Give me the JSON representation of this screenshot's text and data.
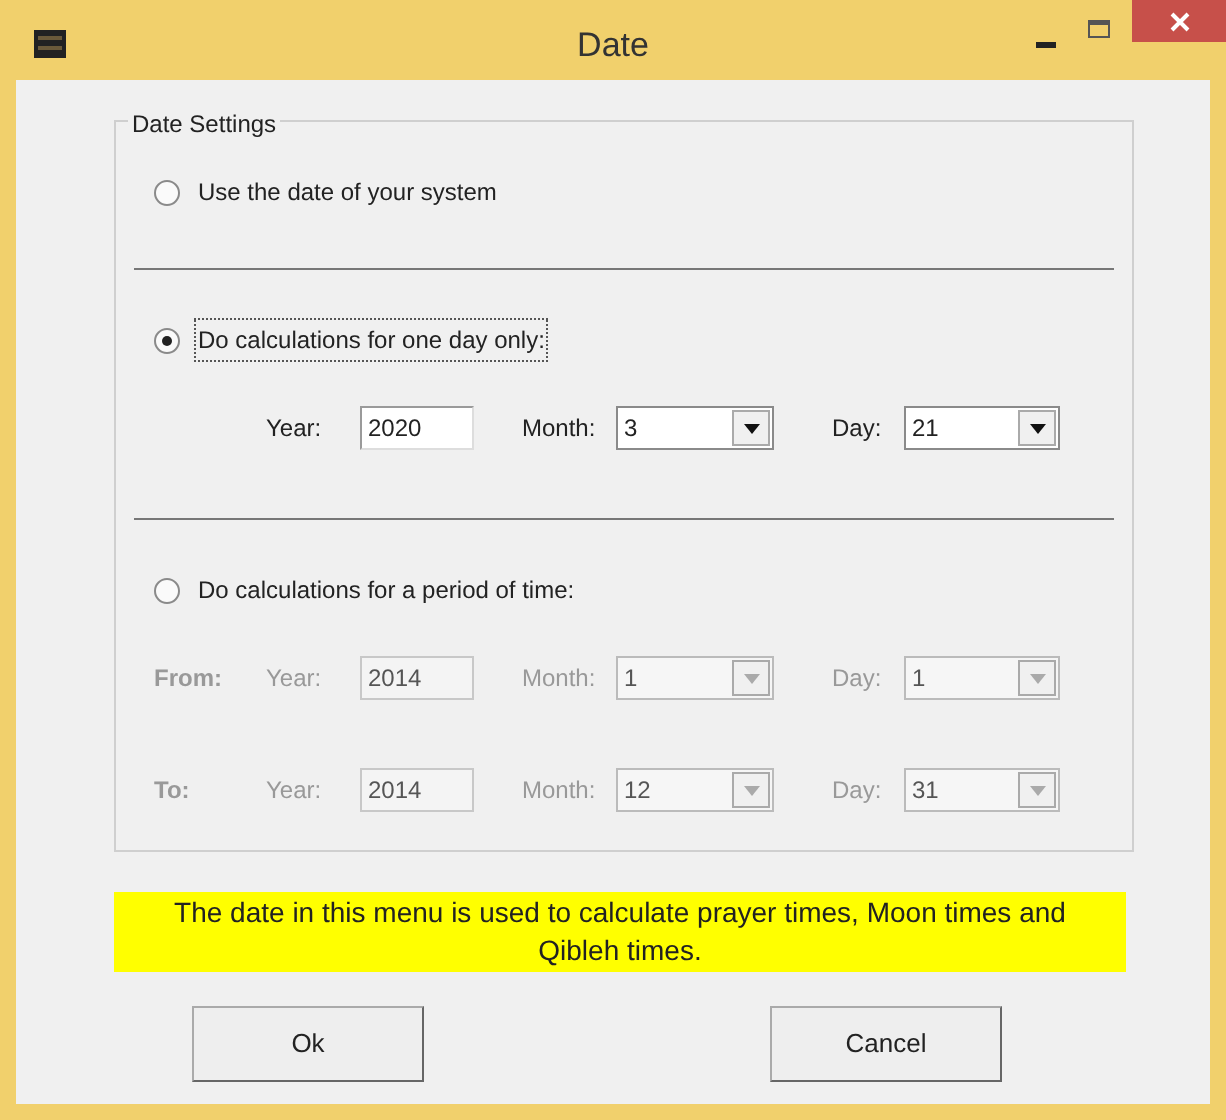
{
  "window": {
    "title": "Date"
  },
  "group": {
    "title": "Date Settings"
  },
  "options": [
    {
      "label": "Use the date of your system",
      "selected": false,
      "focused": false
    },
    {
      "label": "Do calculations for one day only:",
      "selected": true,
      "focused": true,
      "rows": [
        {
          "fields": [
            {
              "kind": "text",
              "label": "Year:",
              "value": "2020",
              "disabled": false
            },
            {
              "kind": "dropdown",
              "label": "Month:",
              "value": "3",
              "disabled": false
            },
            {
              "kind": "dropdown",
              "label": "Day:",
              "value": "21",
              "disabled": false
            }
          ]
        }
      ]
    },
    {
      "label": "Do calculations for a period of time:",
      "selected": false,
      "focused": false,
      "rows": [
        {
          "label": "From:",
          "fields": [
            {
              "kind": "text",
              "label": "Year:",
              "value": "2014",
              "disabled": true
            },
            {
              "kind": "dropdown",
              "label": "Month:",
              "value": "1",
              "disabled": true
            },
            {
              "kind": "dropdown",
              "label": "Day:",
              "value": "1",
              "disabled": true
            }
          ]
        },
        {
          "label": "To:",
          "fields": [
            {
              "kind": "text",
              "label": "Year:",
              "value": "2014",
              "disabled": true
            },
            {
              "kind": "dropdown",
              "label": "Month:",
              "value": "12",
              "disabled": true
            },
            {
              "kind": "dropdown",
              "label": "Day:",
              "value": "31",
              "disabled": true
            }
          ]
        }
      ]
    }
  ],
  "note": "The date in this menu is used to calculate prayer times, Moon times and Qibleh times.",
  "buttons": [
    {
      "label": "Ok"
    },
    {
      "label": "Cancel"
    }
  ]
}
